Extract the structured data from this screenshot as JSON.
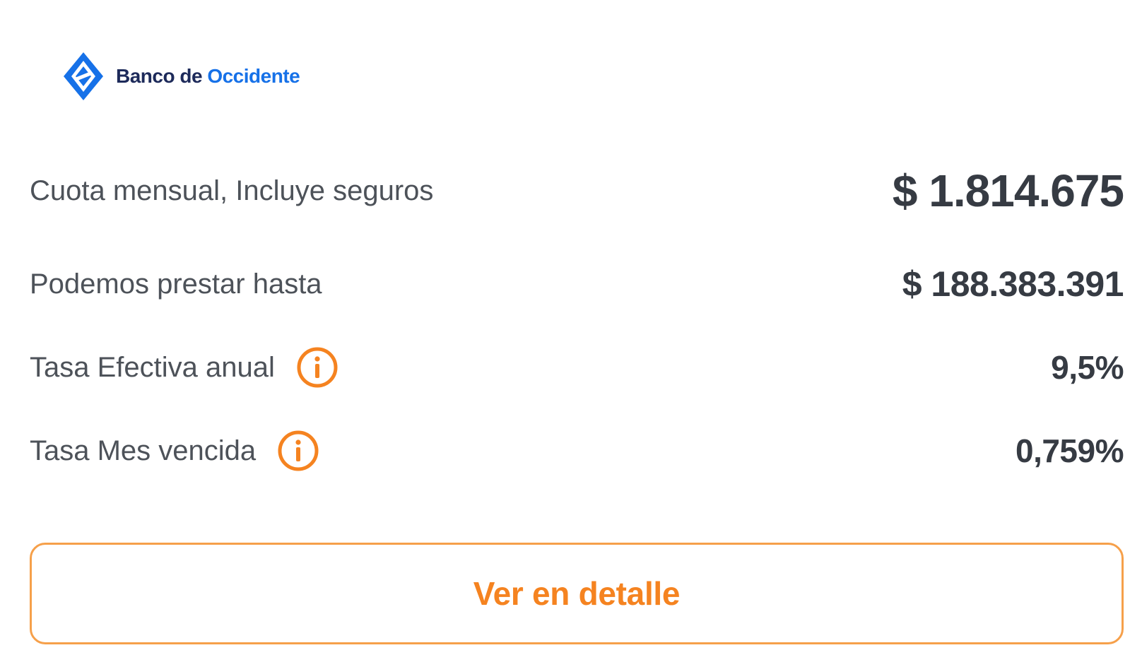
{
  "brand": {
    "name_part1": "Banco de",
    "name_part2": "Occidente",
    "logo_icon": "banco-occidente-diamond-logo",
    "colors": {
      "primary_blue": "#1671e8",
      "dark_navy": "#1d2a5a"
    }
  },
  "summary": {
    "monthly_payment": {
      "label": "Cuota mensual, Incluye seguros",
      "value": "$ 1.814.675"
    },
    "max_loan": {
      "label": "Podemos prestar hasta",
      "value": "$ 188.383.391"
    },
    "annual_rate": {
      "label": "Tasa Efectiva anual",
      "value": "9,5%",
      "icon": "info-icon"
    },
    "monthly_rate": {
      "label": "Tasa Mes vencida",
      "value": "0,759%",
      "icon": "info-icon"
    }
  },
  "actions": {
    "detail_label": "Ver en detalle"
  },
  "colors": {
    "accent_orange": "#f58320",
    "text_dark": "#363b43",
    "text_label": "#4d5259"
  }
}
